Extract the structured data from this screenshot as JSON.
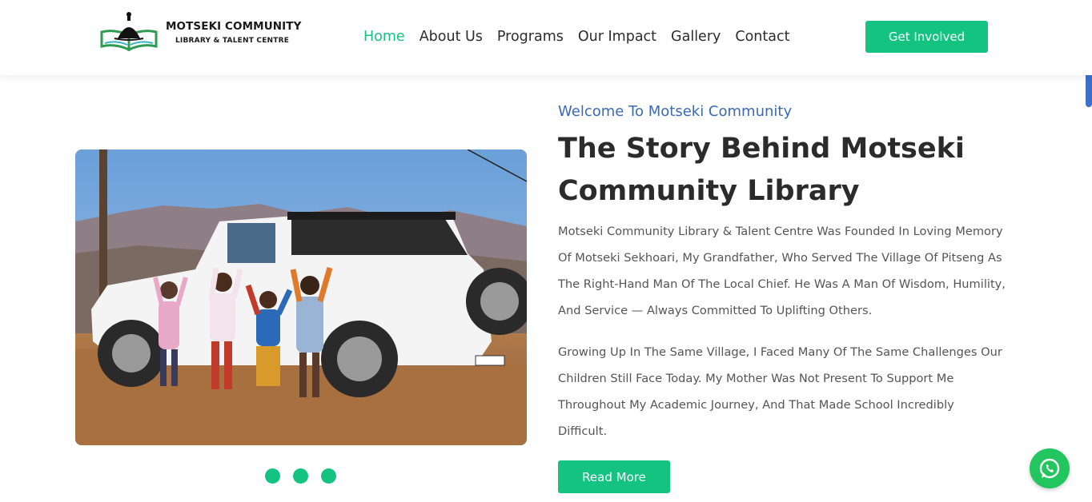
{
  "header": {
    "logo_title": "MOTSEKI COMMUNITY",
    "logo_subtitle": "LIBRARY & TALENT CENTRE",
    "nav": [
      {
        "label": "Home",
        "active": true
      },
      {
        "label": "About Us",
        "active": false
      },
      {
        "label": "Programs",
        "active": false
      },
      {
        "label": "Our Impact",
        "active": false
      },
      {
        "label": "Gallery",
        "active": false
      },
      {
        "label": "Contact",
        "active": false
      }
    ],
    "cta_label": "Get Involved"
  },
  "slider": {
    "image_icon": "photo-children-jeep-icon",
    "dot_count": 3
  },
  "content": {
    "welcome": "Welcome To Motseki Community",
    "heading": "The Story Behind Motseki Community Library",
    "paragraph1": "Motseki Community Library & Talent Centre Was Founded In Loving Memory Of Motseki Sekhoari, My Grandfather, Who Served The Village Of Pitseng As The Right-Hand Man Of The Local Chief. He Was A Man Of Wisdom, Humility, And Service — Always Committed To Uplifting Others.",
    "paragraph2": "Growing Up In The Same Village, I Faced Many Of The Same Challenges Our Children Still Face Today. My Mother Was Not Present To Support Me Throughout My Academic Journey, And That Made School Incredibly Difficult.",
    "read_more": "Read More"
  },
  "colors": {
    "accent": "#14c382",
    "welcome": "#3b6ab5",
    "heading": "#2b2b2b",
    "body": "#555555"
  },
  "floating": {
    "whatsapp_icon": "whatsapp-icon"
  }
}
